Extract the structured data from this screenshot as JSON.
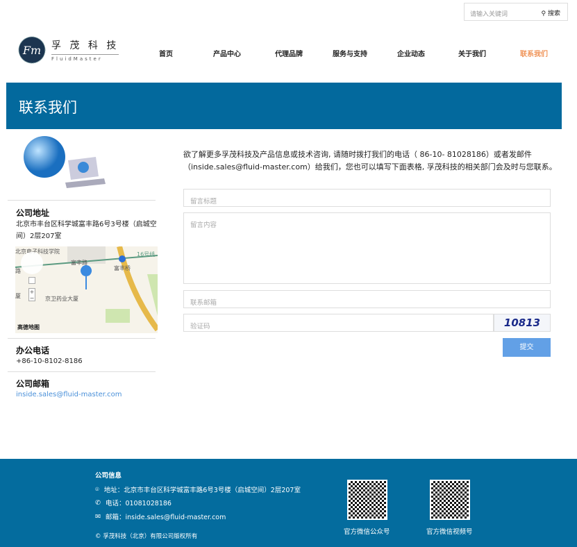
{
  "header": {
    "search_placeholder": "请输入关键词",
    "search_button": "搜索",
    "logo_cn": "孚 茂 科 技",
    "logo_en": "FluidMaster",
    "logo_mark": "Fm"
  },
  "nav": [
    {
      "label": "首页"
    },
    {
      "label": "产品中心"
    },
    {
      "label": "代理品牌"
    },
    {
      "label": "服务与支持"
    },
    {
      "label": "企业动态"
    },
    {
      "label": "关于我们"
    },
    {
      "label": "联系我们",
      "active": true
    }
  ],
  "colors": {
    "accent": "#f0955a",
    "banner": "#03699d",
    "footer": "#046c9e",
    "link": "#4a90d9",
    "submit": "#62a0e6"
  },
  "banner": {
    "title": "联系我们"
  },
  "sidebar": {
    "address_title": "公司地址",
    "address": "北京市丰台区科学城富丰路6号3号楼（启城空间）2层207室",
    "map": {
      "labels": [
        "北京电子科技学院",
        "富丰路",
        "富丰桥",
        "京卫药业大厦",
        "厦",
        "路",
        "16号线"
      ],
      "brand": "高德地图"
    },
    "phone_title": "办公电话",
    "phone": "+86-10-8102-8186",
    "email_title": "公司邮箱",
    "email": "inside.sales@fluid-master.com"
  },
  "main": {
    "intro": "欲了解更多孚茂科技及产品信息或技术咨询, 请随时拨打我们的电话（ 86-10- 81028186）或者发邮件（inside.sales@fluid-master.com）给我们，您也可以填写下面表格, 孚茂科技的相关部门会及时与您联系。",
    "form": {
      "title_placeholder": "留言标题",
      "content_placeholder": "留言内容",
      "email_placeholder": "联系邮箱",
      "captcha_placeholder": "验证码",
      "captcha_text": "10813",
      "submit": "提交"
    }
  },
  "footer": {
    "heading": "公司信息",
    "address": "地址：北京市丰台区科学城富丰路6号3号楼（启城空间）2层207室",
    "phone": "电话：01081028186",
    "email": "邮箱：inside.sales@fluid-master.com",
    "copyright": "© 孚茂科技（北京）有限公司版权所有",
    "qr1": "官方微信公众号",
    "qr2": "官方微信视频号"
  }
}
